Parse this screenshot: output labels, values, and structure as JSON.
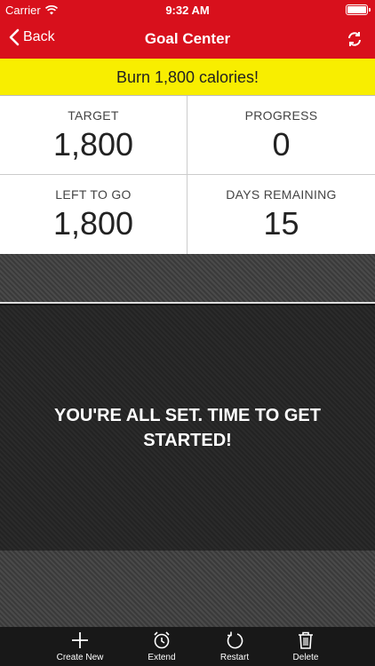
{
  "status_bar": {
    "carrier": "Carrier",
    "time": "9:32 AM"
  },
  "nav": {
    "back_label": "Back",
    "title": "Goal Center",
    "color": "#d8101c"
  },
  "banner": {
    "text": "Burn 1,800 calories!",
    "color": "#f8ee00"
  },
  "stats": [
    {
      "label": "TARGET",
      "value": "1,800"
    },
    {
      "label": "PROGRESS",
      "value": "0"
    },
    {
      "label": "LEFT TO GO",
      "value": "1,800"
    },
    {
      "label": "DAYS REMAINING",
      "value": "15"
    }
  ],
  "message": "YOU'RE ALL SET. TIME TO GET STARTED!",
  "tabbar": {
    "items": [
      {
        "label": "Create New",
        "icon": "plus-icon"
      },
      {
        "label": "Extend",
        "icon": "alarm-clock-icon"
      },
      {
        "label": "Restart",
        "icon": "restart-icon"
      },
      {
        "label": "Delete",
        "icon": "trash-icon"
      }
    ]
  }
}
